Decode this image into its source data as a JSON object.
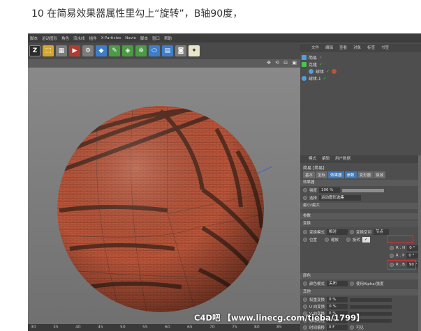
{
  "caption": "10 在简易效果器属性里勾上“旋转”，B轴90度，",
  "menubar": [
    "脚本",
    "运动图形",
    "角色",
    "流水线",
    "插件",
    "X-Particles",
    "Navie",
    "脚本",
    "窗口",
    "帮助"
  ],
  "toolbar_icons": [
    "undo-z-icon",
    "select-icon",
    "film-icon",
    "film-render-icon",
    "film-settings-icon",
    "cube-icon",
    "pen-icon",
    "subdivision-icon",
    "array-icon",
    "deformer-icon",
    "floor-icon",
    "camera-icon",
    "light-icon"
  ],
  "viewport": {
    "nav_icons": "✥ ⟲ ⊡ ▣",
    "ruler_ticks": [
      "30",
      "35",
      "40",
      "45",
      "50",
      "55",
      "60",
      "65",
      "70",
      "75",
      "80",
      "85"
    ]
  },
  "watermark": "C4D吧 【www.linecg.com/tieba/1799】",
  "object_manager": {
    "menu": [
      "文件",
      "编辑",
      "查看",
      "对象",
      "标签",
      "书签"
    ],
    "objects": [
      {
        "name": "简易",
        "color": "#4fa0e0"
      },
      {
        "name": "克隆",
        "color": "#4fc24f"
      },
      {
        "name": "球体",
        "color": "#4fa0e0"
      },
      {
        "name": "球体.1",
        "color": "#4fa0e0"
      }
    ]
  },
  "attribute_manager": {
    "menu": [
      "模式",
      "编辑",
      "用户数据"
    ],
    "title": "简易 [简易]",
    "tabs": [
      "基本",
      "坐标",
      "效果器",
      "参数",
      "变形器",
      "衰减"
    ],
    "active_tab": "参数",
    "effector_section": "效果器",
    "strength_label": "强度",
    "strength_value": "100 %",
    "selection_label": "选择",
    "selection_value": "运动图形选集",
    "minmax_label": "最小/最大",
    "params_section": "参数",
    "transform_section": "变换",
    "transform_mode_label": "变换模式",
    "transform_mode_value": "相对",
    "transform_space_label": "变换空间",
    "transform_space_value": "节点",
    "position_label": "位置",
    "scale_label": "缩放",
    "rotation_label": "旋转",
    "rotation_check": "✓",
    "rh_label": "R . H",
    "rh_value": "0 °",
    "rp_label": "R . P",
    "rp_value": "0 °",
    "rb_label": "R . B",
    "rb_value": "90 °",
    "color_section": "颜色",
    "color_mode_label": "颜色模式",
    "color_mode_value": "关闭",
    "use_alpha_label": "使用Alpha/强度",
    "other_section": "其他",
    "weight_label": "权重变换",
    "weight_value": "0 %",
    "u_label": "U 向变换",
    "u_value": "0 %",
    "v_label": "V 向变换",
    "v_value": "0 %",
    "mod_label": "修改克隆",
    "mod_value": "0 %",
    "time_label": "时间偏移",
    "time_value": "0 F",
    "visible_label": "可见"
  },
  "colors": {
    "accent": "#3f78b5",
    "highlight": "#e03030",
    "brick": "#b8553a"
  }
}
